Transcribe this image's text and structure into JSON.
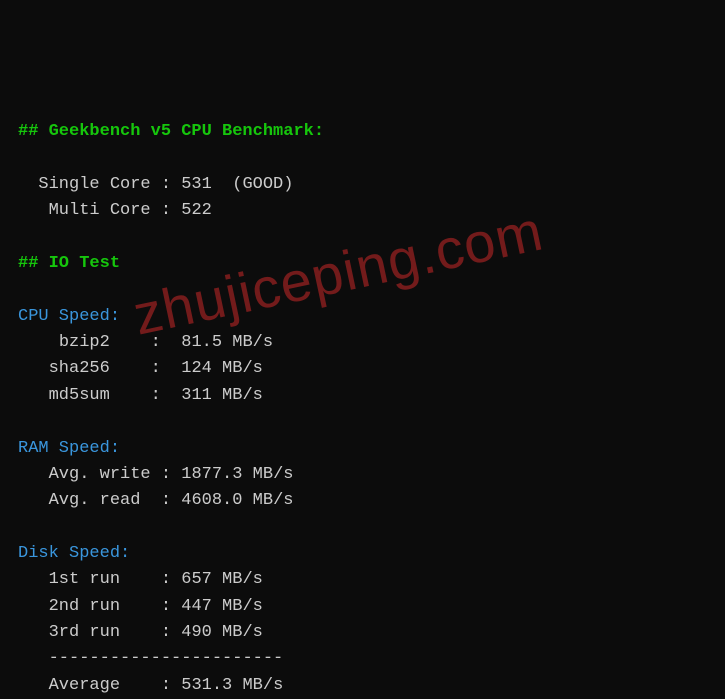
{
  "headings": {
    "geekbench": "## Geekbench v5 CPU Benchmark:",
    "iotest": "## IO Test"
  },
  "geekbench": {
    "single_label": "Single Core",
    "single_value": "531",
    "single_rating": "(GOOD)",
    "multi_label": "Multi Core",
    "multi_value": "522"
  },
  "cpu_speed": {
    "title": "CPU Speed:",
    "rows": [
      {
        "label": "bzip2",
        "value": "81.5 MB/s"
      },
      {
        "label": "sha256",
        "value": "124 MB/s"
      },
      {
        "label": "md5sum",
        "value": "311 MB/s"
      }
    ]
  },
  "ram_speed": {
    "title": "RAM Speed:",
    "rows": [
      {
        "label": "Avg. write",
        "value": "1877.3 MB/s"
      },
      {
        "label": "Avg. read",
        "value": "4608.0 MB/s"
      }
    ]
  },
  "disk_speed": {
    "title": "Disk Speed:",
    "rows": [
      {
        "label": "1st run",
        "value": "657 MB/s"
      },
      {
        "label": "2nd run",
        "value": "447 MB/s"
      },
      {
        "label": "3rd run",
        "value": "490 MB/s"
      }
    ],
    "divider": "-----------------------",
    "avg_label": "Average",
    "avg_value": "531.3 MB/s"
  },
  "watermark": "zhujiceping.com"
}
